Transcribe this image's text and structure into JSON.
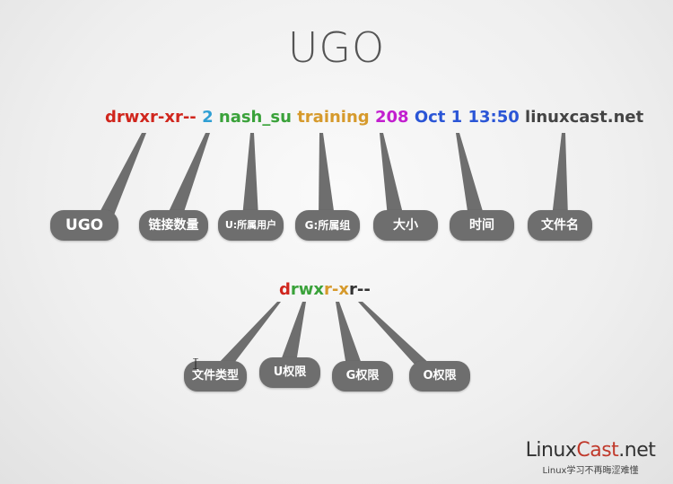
{
  "title": "UGO",
  "ls_line": {
    "segments": [
      {
        "text": "drwxr-xr--",
        "color": "#d0261d"
      },
      {
        "text": "2",
        "color": "#2f9fd4"
      },
      {
        "text": "nash_su",
        "color": "#3aa23a"
      },
      {
        "text": "training",
        "color": "#d69a2c"
      },
      {
        "text": "208",
        "color": "#c21ecf"
      },
      {
        "text": "Oct 1 13:50",
        "color": "#2a55d6"
      },
      {
        "text": "linuxcast.net",
        "color": "#444444"
      }
    ]
  },
  "top_labels": [
    "UGO",
    "链接数量",
    "U:所属用户",
    "G:所属组",
    "大小",
    "时间",
    "文件名"
  ],
  "perm_line": {
    "segments": [
      {
        "text": "d",
        "color": "#d0261d"
      },
      {
        "text": "rwx",
        "color": "#3aa23a"
      },
      {
        "text": "r-x",
        "color": "#d69a2c"
      },
      {
        "text": "r--",
        "color": "#333333"
      }
    ]
  },
  "bottom_labels": [
    "文件类型",
    "U权限",
    "G权限",
    "O权限"
  ],
  "logo": {
    "prefix": "Linux",
    "accent": "Cast",
    "suffix": ".net",
    "tagline": "Linux学习不再晦涩难懂"
  }
}
